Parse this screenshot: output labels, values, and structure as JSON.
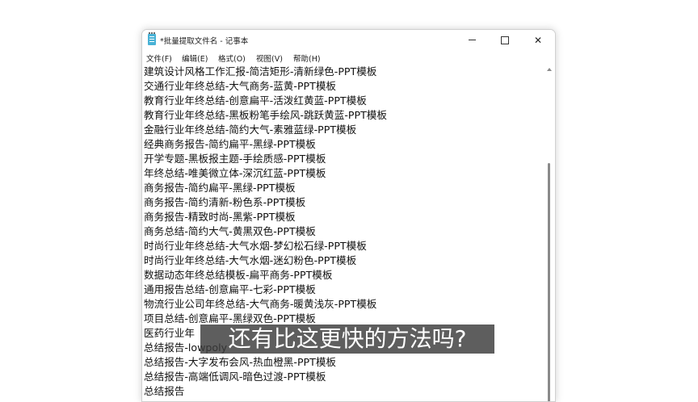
{
  "window": {
    "title": "*批量提取文件名 - 记事本"
  },
  "menu": [
    "文件(F)",
    "编辑(E)",
    "格式(O)",
    "视图(V)",
    "帮助(H)"
  ],
  "lines": [
    "建筑设计风格工作汇报-简洁矩形-清新绿色-PPT模板",
    "交通行业年终总结-大气商务-蓝黄-PPT模板",
    "教育行业年终总结-创意扁平-活泼红黄蓝-PPT模板",
    "教育行业年终总结-黑板粉笔手绘风-跳跃黄蓝-PPT模板",
    "金融行业年终总结-简约大气-素雅蓝绿-PPT模板",
    "经典商务报告-简约扁平-黑绿-PPT模板",
    "开学专题-黑板报主题-手绘质感-PPT模板",
    "年终总结-唯美微立体-深沉红蓝-PPT模板",
    "商务报告-简约扁平-黑绿-PPT模板",
    "商务报告-简约清新-粉色系-PPT模板",
    "商务报告-精致时尚-黑紫-PPT模板",
    "商务总结-简约大气-黄黑双色-PPT模板",
    "时尚行业年终总结-大气水烟-梦幻松石绿-PPT模板",
    "时尚行业年终总结-大气水烟-迷幻粉色-PPT模板",
    "数据动态年终总结模板-扁平商务-PPT模板",
    "通用报告总结-创意扁平-七彩-PPT模板",
    "物流行业公司年终总结-大气商务-暖黄浅灰-PPT模板",
    "项目总结-创意扁平-黑绿双色-PPT模板",
    "医药行业年",
    "总结报告-lowpoly",
    "总结报告-大字发布会风-热血橙黑-PPT模板",
    "总结报告-高端低调风-暗色过渡-PPT模板",
    "总结报告"
  ],
  "subtitle": "还有比这更快的方法吗?"
}
